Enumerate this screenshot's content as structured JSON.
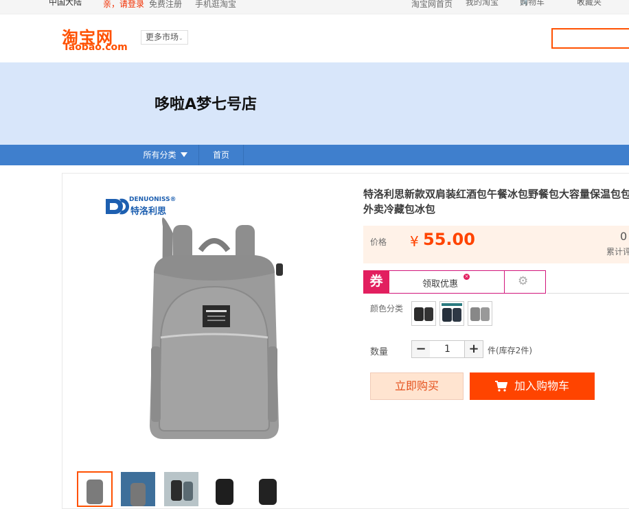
{
  "topbar": {
    "region": "中国大陆",
    "login": "亲，请登录",
    "register": "免费注册",
    "mobile": "手机逛淘宝",
    "home": "淘宝网首页",
    "my_taobao": "我的淘宝",
    "cart": "购物车",
    "favorites": "收藏夹"
  },
  "header": {
    "logo_cn": "淘宝网",
    "logo_en": "Taobao.com",
    "more_markets": "更多市场"
  },
  "shop": {
    "name": "哆啦A梦七号店"
  },
  "nav": {
    "all_categories": "所有分类",
    "home": "首页"
  },
  "product": {
    "brand_en": "DENUONISS®",
    "brand_cn": "特洛利思",
    "title": "特洛利思新款双肩装红酒包午餐冰包野餐包大容量保温包包外卖冷藏包冰包",
    "price_label": "价格",
    "currency": "¥",
    "price": "55.00",
    "sales_count": "0",
    "sales_label": "累计评价",
    "coupon_tag": "券",
    "coupon_text": "领取优惠",
    "color_label": "颜色分类",
    "quantity_label": "数量",
    "quantity": "1",
    "stock": "件(库存2件)",
    "buy_now": "立即购买",
    "add_to_cart": "加入购物车",
    "thumb_colors": [
      "#7b7b7b",
      "#3e6f9a",
      "#5a6a72",
      "#1e1e1e",
      "#222"
    ],
    "swatch_colors": [
      "#2b2b2b",
      "#26303c",
      "#888"
    ]
  }
}
